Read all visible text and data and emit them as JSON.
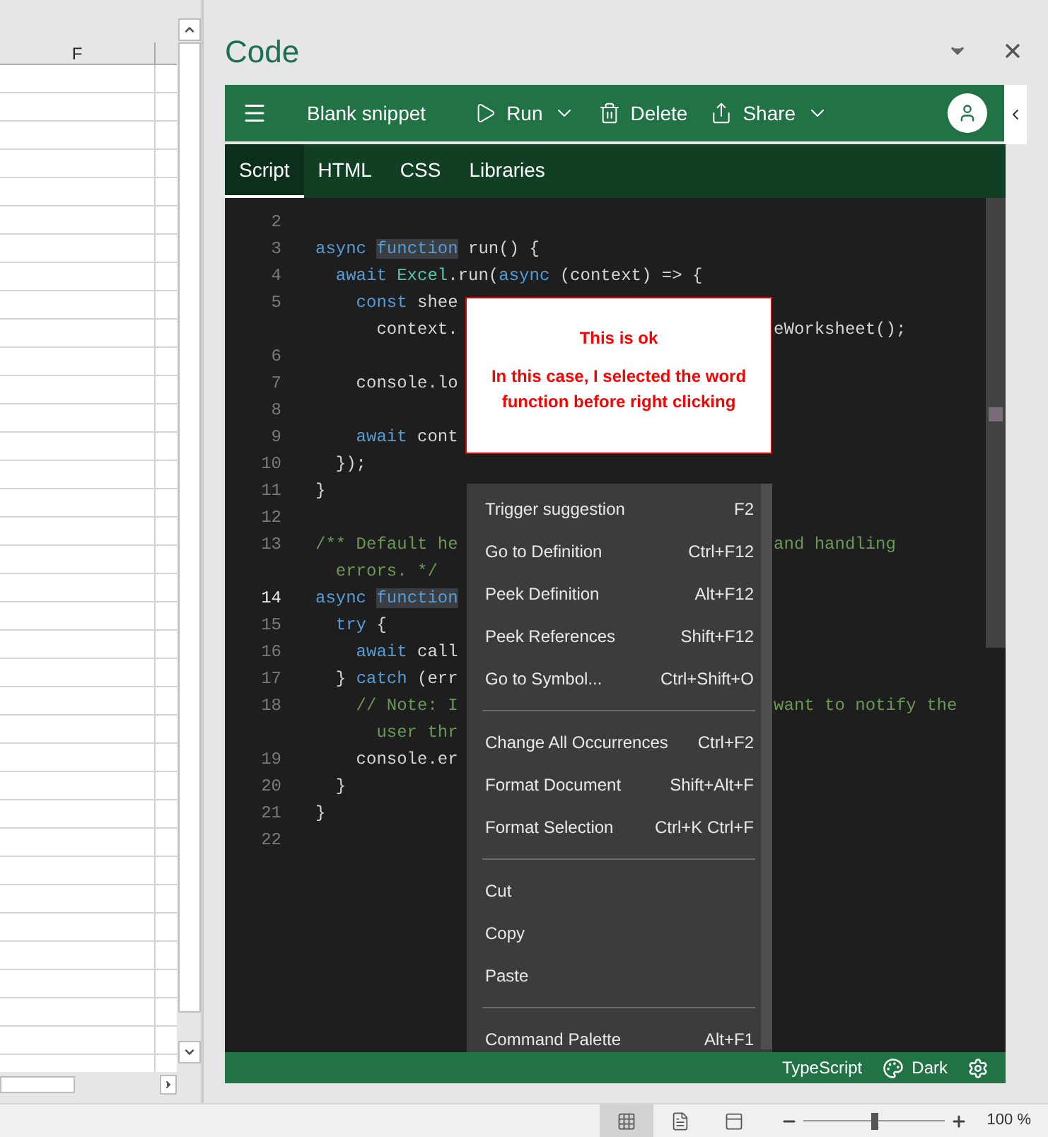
{
  "sheet": {
    "column_header": "F"
  },
  "pane": {
    "title": "Code"
  },
  "toolbar": {
    "snippet_name": "Blank snippet",
    "buttons": [
      {
        "label": "Run",
        "kind": "dropdown"
      },
      {
        "label": "Delete",
        "kind": "plain"
      },
      {
        "label": "Share",
        "kind": "dropdown"
      }
    ]
  },
  "tabs": [
    {
      "label": "Script",
      "selected": true
    },
    {
      "label": "HTML",
      "selected": false
    },
    {
      "label": "CSS",
      "selected": false
    },
    {
      "label": "Libraries",
      "selected": false
    }
  ],
  "editor": {
    "lines": [
      {
        "number": "2",
        "current": false
      },
      {
        "number": "3",
        "current": false,
        "tokens": [
          {
            "t": "async ",
            "kind": "keyword"
          },
          {
            "t": "function",
            "kind": "keyword",
            "marked": true
          },
          {
            "t": " run() {",
            "kind": "plain"
          }
        ]
      },
      {
        "number": "4",
        "current": false,
        "tokens": [
          {
            "t": "  await ",
            "kind": "keyword"
          },
          {
            "t": "Excel",
            "kind": "class"
          },
          {
            "t": ".run(",
            "kind": "plain"
          },
          {
            "t": "async",
            "kind": "keyword"
          },
          {
            "t": " (context) => {",
            "kind": "plain"
          }
        ]
      },
      {
        "number": "5",
        "current": false,
        "tokens": [
          {
            "t": "    const",
            "kind": "keyword"
          },
          {
            "t": " shee",
            "kind": "plain"
          }
        ]
      },
      {
        "tokens": [
          {
            "t": "      context.",
            "kind": "plain"
          }
        ],
        "tail": [
          {
            "t": "eWorksheet();",
            "kind": "plain"
          }
        ]
      },
      {
        "number": "6",
        "current": false
      },
      {
        "number": "7",
        "current": false,
        "tokens": [
          {
            "t": "    console.lo",
            "kind": "plain"
          }
        ]
      },
      {
        "number": "8",
        "current": false
      },
      {
        "number": "9",
        "current": false,
        "tokens": [
          {
            "t": "    await",
            "kind": "keyword"
          },
          {
            "t": " cont",
            "kind": "plain"
          }
        ]
      },
      {
        "number": "10",
        "current": false,
        "tokens": [
          {
            "t": "  });",
            "kind": "plain"
          }
        ]
      },
      {
        "number": "11",
        "current": false,
        "tokens": [
          {
            "t": "}",
            "kind": "plain"
          }
        ]
      },
      {
        "number": "12",
        "current": false
      },
      {
        "number": "13",
        "current": false,
        "tokens": [
          {
            "t": "/** Default he",
            "kind": "comment"
          }
        ],
        "tail": [
          {
            "t": "and handling",
            "kind": "comment"
          }
        ]
      },
      {
        "tokens": [
          {
            "t": "  errors. */",
            "kind": "comment"
          }
        ]
      },
      {
        "number": "14",
        "current": true,
        "tokens": [
          {
            "t": "async ",
            "kind": "keyword"
          },
          {
            "t": "function",
            "kind": "keyword",
            "marked": true
          }
        ]
      },
      {
        "number": "15",
        "current": false,
        "tokens": [
          {
            "t": "  try",
            "kind": "keyword"
          },
          {
            "t": " {",
            "kind": "plain"
          }
        ]
      },
      {
        "number": "16",
        "current": false,
        "tokens": [
          {
            "t": "    await",
            "kind": "keyword"
          },
          {
            "t": " call",
            "kind": "plain"
          }
        ]
      },
      {
        "number": "17",
        "current": false,
        "tokens": [
          {
            "t": "  } ",
            "kind": "plain"
          },
          {
            "t": "catch",
            "kind": "keyword"
          },
          {
            "t": " (err",
            "kind": "plain"
          }
        ]
      },
      {
        "number": "18",
        "current": false,
        "tokens": [
          {
            "t": "    // Note: I",
            "kind": "comment"
          }
        ],
        "tail": [
          {
            "t": "want to notify the",
            "kind": "comment"
          }
        ]
      },
      {
        "tokens": [
          {
            "t": "      user thr",
            "kind": "comment"
          }
        ]
      },
      {
        "number": "19",
        "current": false,
        "tokens": [
          {
            "t": "    console.er",
            "kind": "plain"
          }
        ]
      },
      {
        "number": "20",
        "current": false,
        "tokens": [
          {
            "t": "  }",
            "kind": "plain"
          }
        ]
      },
      {
        "number": "21",
        "current": false,
        "tokens": [
          {
            "t": "}",
            "kind": "plain"
          }
        ]
      },
      {
        "number": "22",
        "current": false
      }
    ]
  },
  "callout": {
    "title": "This is ok",
    "text": "In this case, I selected the word function before right clicking"
  },
  "context_menu": {
    "items": [
      {
        "kind": "item",
        "label": "Trigger suggestion",
        "shortcut": "F2"
      },
      {
        "kind": "item",
        "label": "Go to Definition",
        "shortcut": "Ctrl+F12"
      },
      {
        "kind": "item",
        "label": "Peek Definition",
        "shortcut": "Alt+F12"
      },
      {
        "kind": "item",
        "label": "Peek References",
        "shortcut": "Shift+F12"
      },
      {
        "kind": "item",
        "label": "Go to Symbol...",
        "shortcut": "Ctrl+Shift+O"
      },
      {
        "kind": "separator"
      },
      {
        "kind": "item",
        "label": "Change All Occurrences",
        "shortcut": "Ctrl+F2"
      },
      {
        "kind": "item",
        "label": "Format Document",
        "shortcut": "Shift+Alt+F"
      },
      {
        "kind": "item",
        "label": "Format Selection",
        "shortcut": "Ctrl+K Ctrl+F"
      },
      {
        "kind": "separator"
      },
      {
        "kind": "item",
        "label": "Cut"
      },
      {
        "kind": "item",
        "label": "Copy"
      },
      {
        "kind": "item",
        "label": "Paste"
      },
      {
        "kind": "separator"
      },
      {
        "kind": "item",
        "label": "Command Palette",
        "shortcut": "Alt+F1"
      }
    ]
  },
  "footer": {
    "language": "TypeScript",
    "theme": "Dark"
  },
  "status_bar": {
    "views": [
      {
        "selected": true
      },
      {
        "selected": false
      },
      {
        "selected": false
      }
    ],
    "zoom": {
      "level": 0.5
    },
    "zoom_label": "100 %"
  }
}
